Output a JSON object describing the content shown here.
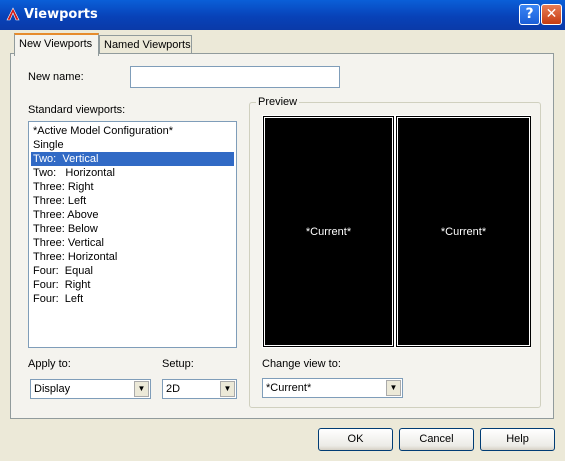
{
  "window": {
    "title": "Viewports",
    "help_glyph": "?",
    "close_glyph": "✕"
  },
  "tabs": [
    {
      "label": "New Viewports",
      "active": true
    },
    {
      "label": "Named Viewports",
      "active": false
    }
  ],
  "new_name": {
    "label": "New name:",
    "value": ""
  },
  "standard_viewports": {
    "label": "Standard viewports:",
    "items": [
      "*Active Model Configuration*",
      "Single",
      "Two:  Vertical",
      "Two:   Horizontal",
      "Three: Right",
      "Three: Left",
      "Three: Above",
      "Three: Below",
      "Three: Vertical",
      "Three: Horizontal",
      "Four:  Equal",
      "Four:  Right",
      "Four:  Left"
    ],
    "selected": "Two:  Vertical"
  },
  "apply_to": {
    "label": "Apply to:",
    "value": "Display"
  },
  "setup": {
    "label": "Setup:",
    "value": "2D"
  },
  "preview": {
    "label": "Preview",
    "viewports": [
      "*Current*",
      "*Current*"
    ]
  },
  "change_view": {
    "label": "Change view to:",
    "value": "*Current*"
  },
  "buttons": {
    "ok": "OK",
    "cancel": "Cancel",
    "help": "Help"
  },
  "colors": {
    "titlebar": "#0a4fc8",
    "selection": "#316ac5",
    "viewport_bg": "#000000"
  }
}
